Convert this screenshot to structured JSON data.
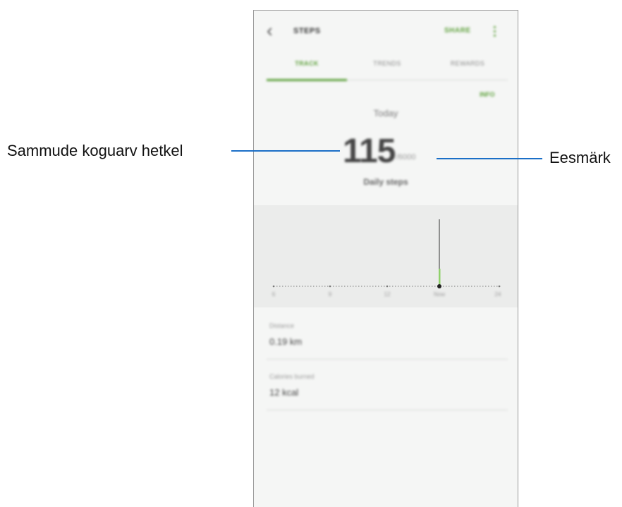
{
  "annotations": {
    "current_steps_label": "Sammude koguarv hetkel",
    "goal_label": "Eesmärk"
  },
  "app": {
    "title": "STEPS",
    "share_label": "SHARE",
    "back_icon": "chevron-left-icon",
    "more_icon": "more-vertical-icon",
    "accent_color": "#5ea13c"
  },
  "tabs": [
    {
      "label": "TRACK",
      "active": true
    },
    {
      "label": "TRENDS",
      "active": false
    },
    {
      "label": "REWARDS",
      "active": false
    }
  ],
  "main": {
    "info_label": "INFO",
    "day_label": "Today",
    "steps_count": "115",
    "goal_text": "/6000",
    "daily_label": "Daily steps"
  },
  "chart_ticks": [
    "6",
    "9",
    "12",
    "Now",
    "24"
  ],
  "stats": [
    {
      "label": "Distance",
      "value": "0.19 km"
    },
    {
      "label": "Calories burned",
      "value": "12 kcal"
    }
  ]
}
